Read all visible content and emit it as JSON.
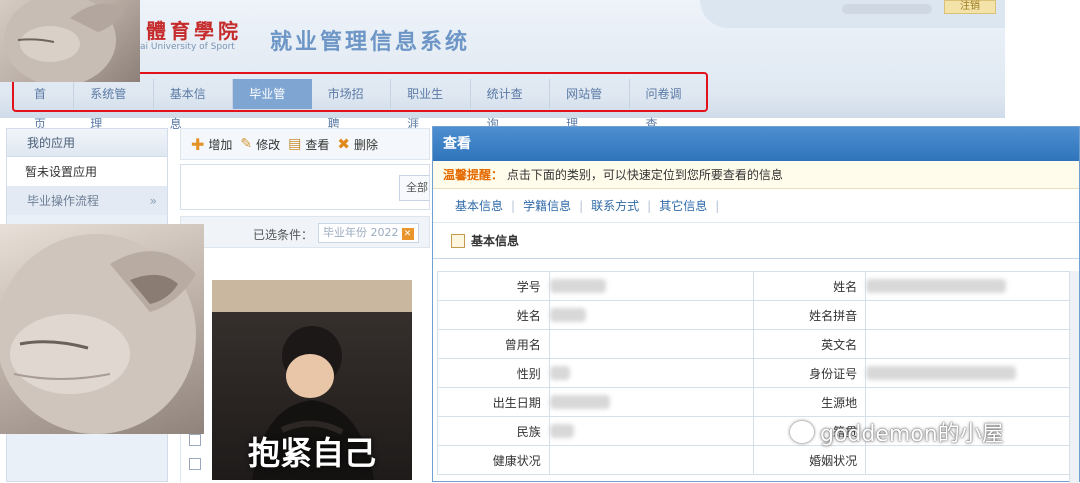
{
  "header": {
    "school_name": "體育學院",
    "school_en": "ai University of Sport",
    "system_title": "就业管理信息系统",
    "logout_label": "注销"
  },
  "nav": {
    "items": [
      "首页",
      "系统管理",
      "基本信息",
      "毕业管理",
      "市场招聘",
      "职业生涯",
      "统计查询",
      "网站管理",
      "问卷调查"
    ],
    "active": "毕业管理"
  },
  "sidebar": {
    "title": "我的应用",
    "item": "暂未设置应用",
    "flow": "毕业操作流程",
    "flow_arrow": "»"
  },
  "toolbar": {
    "add": "增加",
    "edit": "修改",
    "view": "查看",
    "delete": "删除"
  },
  "filter": {
    "all_button": "全部",
    "selected_label": "已选条件：",
    "tag": "毕业年份 2022"
  },
  "overlay": {
    "caption": "抱紧自己",
    "watermark": "goddemon的小屋"
  },
  "modal": {
    "title": "查看",
    "tip_label": "温馨提醒：",
    "tip_text": "点击下面的类别，可以快速定位到您所要查看的信息",
    "tabs": [
      "基本信息",
      "学籍信息",
      "联系方式",
      "其它信息"
    ],
    "section": "基本信息",
    "rows": [
      {
        "l1": "学号",
        "l2": "姓名"
      },
      {
        "l1": "姓名",
        "l2": "姓名拼音"
      },
      {
        "l1": "曾用名",
        "l2": "英文名"
      },
      {
        "l1": "性别",
        "l2": "身份证号"
      },
      {
        "l1": "出生日期",
        "l2": "生源地"
      },
      {
        "l1": "民族",
        "l2": "籍贯"
      },
      {
        "l1": "健康状况",
        "l2": "婚姻状况"
      }
    ]
  },
  "colors": {
    "nav_active": "#7fa6d3",
    "highlight_box": "#e3111b",
    "modal_header": "#2f74bb",
    "tip_label": "#e56a00"
  }
}
